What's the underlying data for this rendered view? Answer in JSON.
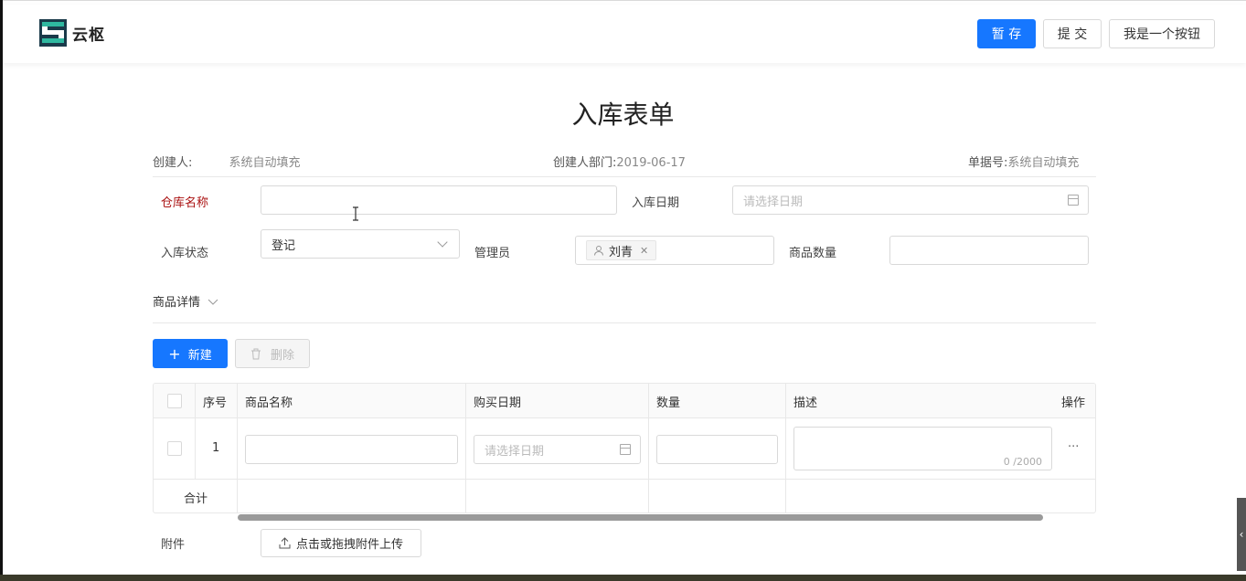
{
  "header": {
    "logo_text": "云枢",
    "save_label": "暂 存",
    "submit_label": "提 交",
    "custom_label": "我是一个按钮",
    "brand_color": "#1677ff"
  },
  "form": {
    "title": "入库表单",
    "meta": {
      "creator_label": "创建人:",
      "creator_value": "系统自动填充",
      "dept_label": "创建人部门:",
      "dept_value": "2019-06-17",
      "doc_no_label": "单据号:",
      "doc_no_value": "系统自动填充"
    },
    "fields": {
      "warehouse_label": "仓库名称",
      "warehouse_value": "",
      "in_date_label": "入库日期",
      "in_date_placeholder": "请选择日期",
      "status_label": "入库状态",
      "status_value": "登记",
      "manager_label": "管理员",
      "manager_value": "刘青",
      "qty_label": "商品数量",
      "qty_value": ""
    },
    "section_title": "商品详情",
    "new_label": "新建",
    "delete_label": "删除",
    "table": {
      "columns": [
        "序号",
        "商品名称",
        "购买日期",
        "数量",
        "描述",
        "操作"
      ],
      "rows": [
        {
          "index": "1",
          "name": "",
          "date_placeholder": "请选择日期",
          "qty": "",
          "desc": "",
          "counter": "0 /2000",
          "action": "···"
        }
      ],
      "total_label": "合计"
    },
    "attachment_label": "附件",
    "upload_label": "点击或拖拽附件上传"
  },
  "side_handle": "‹"
}
